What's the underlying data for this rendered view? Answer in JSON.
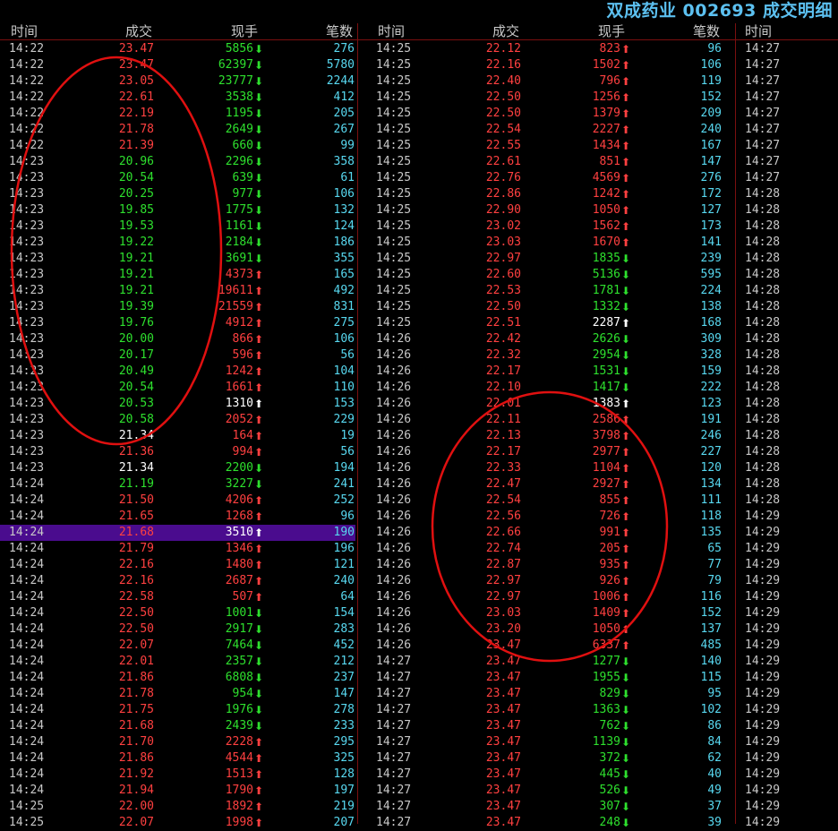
{
  "title": "双成药业 002693 成交明细",
  "headers": {
    "time": "时间",
    "price": "成交",
    "volume": "现手",
    "count": "笔数"
  },
  "colors": {
    "up": "#ff4040",
    "down": "#2ee02e",
    "flat": "#ffffff",
    "count": "#58d8f0",
    "highlight": "#4a0c8e",
    "annotation": "#e01010"
  },
  "highlight_row": {
    "column": 0,
    "index": 30
  },
  "col1": [
    [
      "14:22",
      "23.47",
      "r",
      "5856",
      "d",
      "276"
    ],
    [
      "14:22",
      "23.47",
      "r",
      "62397",
      "d",
      "5780"
    ],
    [
      "14:22",
      "23.05",
      "r",
      "23777",
      "d",
      "2244"
    ],
    [
      "14:22",
      "22.61",
      "r",
      "3538",
      "d",
      "412"
    ],
    [
      "14:22",
      "22.19",
      "r",
      "1195",
      "d",
      "205"
    ],
    [
      "14:22",
      "21.78",
      "r",
      "2649",
      "d",
      "267"
    ],
    [
      "14:22",
      "21.39",
      "r",
      "660",
      "d",
      "99"
    ],
    [
      "14:23",
      "20.96",
      "g",
      "2296",
      "d",
      "358"
    ],
    [
      "14:23",
      "20.54",
      "g",
      "639",
      "d",
      "61"
    ],
    [
      "14:23",
      "20.25",
      "g",
      "977",
      "d",
      "106"
    ],
    [
      "14:23",
      "19.85",
      "g",
      "1775",
      "d",
      "132"
    ],
    [
      "14:23",
      "19.53",
      "g",
      "1161",
      "d",
      "124"
    ],
    [
      "14:23",
      "19.22",
      "g",
      "2184",
      "d",
      "186"
    ],
    [
      "14:23",
      "19.21",
      "g",
      "3691",
      "d",
      "355"
    ],
    [
      "14:23",
      "19.21",
      "g",
      "4373",
      "u",
      "165"
    ],
    [
      "14:23",
      "19.21",
      "g",
      "19611",
      "u",
      "492"
    ],
    [
      "14:23",
      "19.39",
      "g",
      "21559",
      "u",
      "831"
    ],
    [
      "14:23",
      "19.76",
      "g",
      "4912",
      "u",
      "275"
    ],
    [
      "14:23",
      "20.00",
      "g",
      "866",
      "u",
      "106"
    ],
    [
      "14:23",
      "20.17",
      "g",
      "596",
      "u",
      "56"
    ],
    [
      "14:23",
      "20.49",
      "g",
      "1242",
      "u",
      "104"
    ],
    [
      "14:23",
      "20.54",
      "g",
      "1661",
      "u",
      "110"
    ],
    [
      "14:23",
      "20.53",
      "g",
      "1310",
      "n",
      "153"
    ],
    [
      "14:23",
      "20.58",
      "g",
      "2052",
      "u",
      "229"
    ],
    [
      "14:23",
      "21.34",
      "w",
      "164",
      "u",
      "19"
    ],
    [
      "14:23",
      "21.36",
      "r",
      "994",
      "u",
      "56"
    ],
    [
      "14:23",
      "21.34",
      "w",
      "2200",
      "d",
      "194"
    ],
    [
      "14:24",
      "21.19",
      "g",
      "3227",
      "d",
      "241"
    ],
    [
      "14:24",
      "21.50",
      "r",
      "4206",
      "u",
      "252"
    ],
    [
      "14:24",
      "21.65",
      "r",
      "1268",
      "u",
      "96"
    ],
    [
      "14:24",
      "21.68",
      "r",
      "3510",
      "n",
      "190"
    ],
    [
      "14:24",
      "21.79",
      "r",
      "1346",
      "u",
      "196"
    ],
    [
      "14:24",
      "22.16",
      "r",
      "1480",
      "u",
      "121"
    ],
    [
      "14:24",
      "22.16",
      "r",
      "2687",
      "u",
      "240"
    ],
    [
      "14:24",
      "22.58",
      "r",
      "507",
      "u",
      "64"
    ],
    [
      "14:24",
      "22.50",
      "r",
      "1001",
      "d",
      "154"
    ],
    [
      "14:24",
      "22.50",
      "r",
      "2917",
      "d",
      "283"
    ],
    [
      "14:24",
      "22.07",
      "r",
      "7464",
      "d",
      "452"
    ],
    [
      "14:24",
      "22.01",
      "r",
      "2357",
      "d",
      "212"
    ],
    [
      "14:24",
      "21.86",
      "r",
      "6808",
      "d",
      "237"
    ],
    [
      "14:24",
      "21.78",
      "r",
      "954",
      "d",
      "147"
    ],
    [
      "14:24",
      "21.75",
      "r",
      "1976",
      "d",
      "278"
    ],
    [
      "14:24",
      "21.68",
      "r",
      "2439",
      "d",
      "233"
    ],
    [
      "14:24",
      "21.70",
      "r",
      "2228",
      "u",
      "295"
    ],
    [
      "14:24",
      "21.86",
      "r",
      "4544",
      "u",
      "325"
    ],
    [
      "14:24",
      "21.92",
      "r",
      "1513",
      "u",
      "128"
    ],
    [
      "14:24",
      "21.94",
      "r",
      "1790",
      "u",
      "197"
    ],
    [
      "14:25",
      "22.00",
      "r",
      "1892",
      "u",
      "219"
    ],
    [
      "14:25",
      "22.07",
      "r",
      "1998",
      "u",
      "207"
    ]
  ],
  "col2": [
    [
      "14:25",
      "22.12",
      "r",
      "823",
      "u",
      "96"
    ],
    [
      "14:25",
      "22.16",
      "r",
      "1502",
      "u",
      "106"
    ],
    [
      "14:25",
      "22.40",
      "r",
      "796",
      "u",
      "119"
    ],
    [
      "14:25",
      "22.50",
      "r",
      "1256",
      "u",
      "152"
    ],
    [
      "14:25",
      "22.50",
      "r",
      "1379",
      "u",
      "209"
    ],
    [
      "14:25",
      "22.54",
      "r",
      "2227",
      "u",
      "240"
    ],
    [
      "14:25",
      "22.55",
      "r",
      "1434",
      "u",
      "167"
    ],
    [
      "14:25",
      "22.61",
      "r",
      "851",
      "u",
      "147"
    ],
    [
      "14:25",
      "22.76",
      "r",
      "4569",
      "u",
      "276"
    ],
    [
      "14:25",
      "22.86",
      "r",
      "1242",
      "u",
      "172"
    ],
    [
      "14:25",
      "22.90",
      "r",
      "1050",
      "u",
      "127"
    ],
    [
      "14:25",
      "23.02",
      "r",
      "1562",
      "u",
      "173"
    ],
    [
      "14:25",
      "23.03",
      "r",
      "1670",
      "u",
      "141"
    ],
    [
      "14:25",
      "22.97",
      "r",
      "1835",
      "d",
      "239"
    ],
    [
      "14:25",
      "22.60",
      "r",
      "5136",
      "d",
      "595"
    ],
    [
      "14:25",
      "22.53",
      "r",
      "1781",
      "d",
      "224"
    ],
    [
      "14:25",
      "22.50",
      "r",
      "1332",
      "d",
      "138"
    ],
    [
      "14:25",
      "22.51",
      "r",
      "2287",
      "n",
      "168"
    ],
    [
      "14:26",
      "22.42",
      "r",
      "2626",
      "d",
      "309"
    ],
    [
      "14:26",
      "22.32",
      "r",
      "2954",
      "d",
      "328"
    ],
    [
      "14:26",
      "22.17",
      "r",
      "1531",
      "d",
      "159"
    ],
    [
      "14:26",
      "22.10",
      "r",
      "1417",
      "d",
      "222"
    ],
    [
      "14:26",
      "22.01",
      "r",
      "1383",
      "n",
      "123"
    ],
    [
      "14:26",
      "22.11",
      "r",
      "2586",
      "u",
      "191"
    ],
    [
      "14:26",
      "22.13",
      "r",
      "3798",
      "u",
      "246"
    ],
    [
      "14:26",
      "22.17",
      "r",
      "2977",
      "u",
      "227"
    ],
    [
      "14:26",
      "22.33",
      "r",
      "1104",
      "u",
      "120"
    ],
    [
      "14:26",
      "22.47",
      "r",
      "2927",
      "u",
      "134"
    ],
    [
      "14:26",
      "22.54",
      "r",
      "855",
      "u",
      "111"
    ],
    [
      "14:26",
      "22.56",
      "r",
      "726",
      "u",
      "118"
    ],
    [
      "14:26",
      "22.66",
      "r",
      "991",
      "u",
      "135"
    ],
    [
      "14:26",
      "22.74",
      "r",
      "205",
      "u",
      "65"
    ],
    [
      "14:26",
      "22.87",
      "r",
      "935",
      "u",
      "77"
    ],
    [
      "14:26",
      "22.97",
      "r",
      "926",
      "u",
      "79"
    ],
    [
      "14:26",
      "22.97",
      "r",
      "1006",
      "u",
      "116"
    ],
    [
      "14:26",
      "23.03",
      "r",
      "1409",
      "u",
      "152"
    ],
    [
      "14:26",
      "23.20",
      "r",
      "1050",
      "u",
      "137"
    ],
    [
      "14:26",
      "23.47",
      "r",
      "6337",
      "u",
      "485"
    ],
    [
      "14:27",
      "23.47",
      "r",
      "1277",
      "d",
      "140"
    ],
    [
      "14:27",
      "23.47",
      "r",
      "1955",
      "d",
      "115"
    ],
    [
      "14:27",
      "23.47",
      "r",
      "829",
      "d",
      "95"
    ],
    [
      "14:27",
      "23.47",
      "r",
      "1363",
      "d",
      "102"
    ],
    [
      "14:27",
      "23.47",
      "r",
      "762",
      "d",
      "86"
    ],
    [
      "14:27",
      "23.47",
      "r",
      "1139",
      "d",
      "84"
    ],
    [
      "14:27",
      "23.47",
      "r",
      "372",
      "d",
      "62"
    ],
    [
      "14:27",
      "23.47",
      "r",
      "445",
      "d",
      "40"
    ],
    [
      "14:27",
      "23.47",
      "r",
      "526",
      "d",
      "49"
    ],
    [
      "14:27",
      "23.47",
      "r",
      "307",
      "d",
      "37"
    ],
    [
      "14:27",
      "23.47",
      "r",
      "248",
      "d",
      "39"
    ]
  ],
  "col3": [
    "14:27",
    "14:27",
    "14:27",
    "14:27",
    "14:27",
    "14:27",
    "14:27",
    "14:27",
    "14:27",
    "14:28",
    "14:28",
    "14:28",
    "14:28",
    "14:28",
    "14:28",
    "14:28",
    "14:28",
    "14:28",
    "14:28",
    "14:28",
    "14:28",
    "14:28",
    "14:28",
    "14:28",
    "14:28",
    "14:28",
    "14:28",
    "14:28",
    "14:28",
    "14:29",
    "14:29",
    "14:29",
    "14:29",
    "14:29",
    "14:29",
    "14:29",
    "14:29",
    "14:29",
    "14:29",
    "14:29",
    "14:29",
    "14:29",
    "14:29",
    "14:29",
    "14:29",
    "14:29",
    "14:29",
    "14:29",
    "14:29"
  ]
}
